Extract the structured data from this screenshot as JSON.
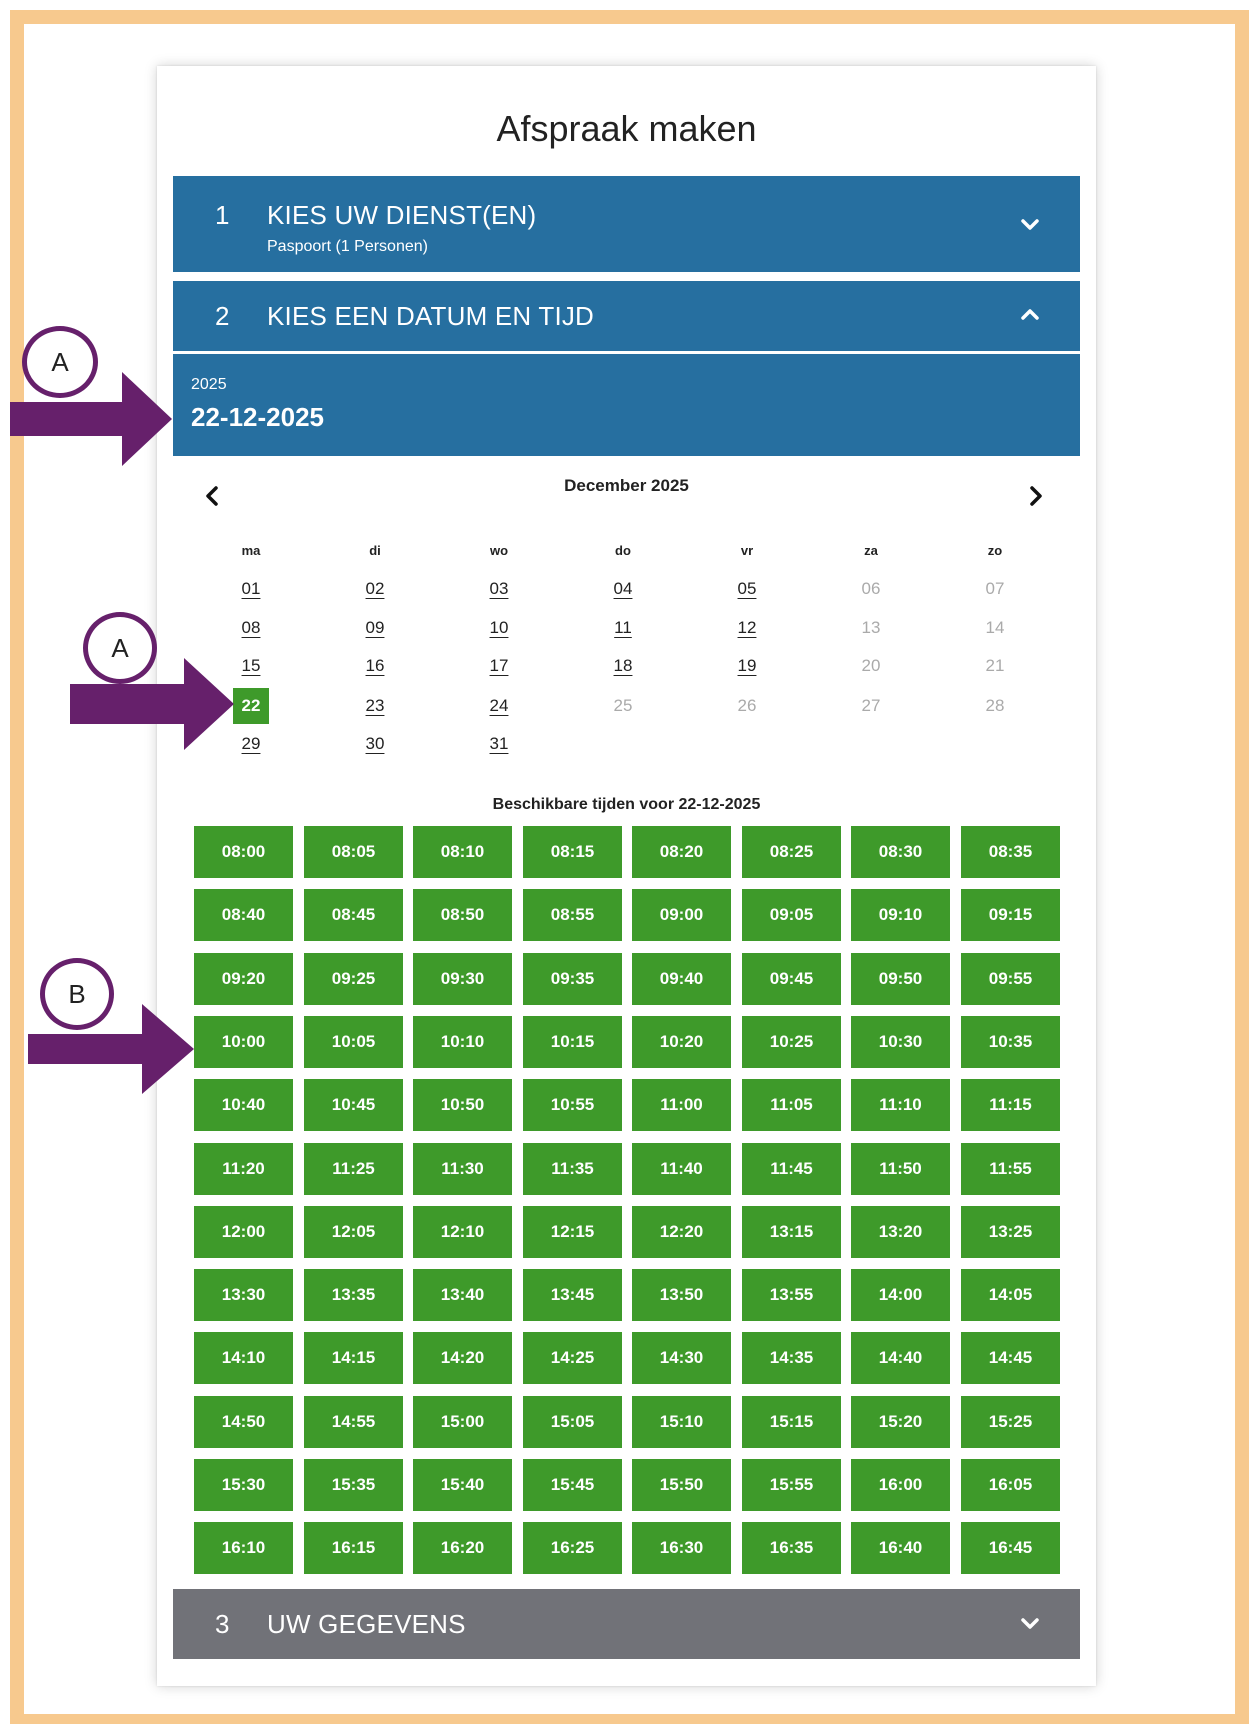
{
  "page_title": "Afspraak maken",
  "steps": [
    {
      "number": "1",
      "title": "KIES UW DIENST(EN)",
      "subtitle": "Paspoort (1 Personen)",
      "chevron": "chevron-down-icon"
    },
    {
      "number": "2",
      "title": "KIES EEN DATUM EN TIJD",
      "chevron": "chevron-up-icon"
    },
    {
      "number": "3",
      "title": "UW GEGEVENS",
      "chevron": "chevron-down-icon"
    }
  ],
  "selected_date": {
    "year": "2025",
    "full": "22-12-2025"
  },
  "calendar": {
    "month_label": "December 2025",
    "weekdays": [
      "ma",
      "di",
      "wo",
      "do",
      "vr",
      "za",
      "zo"
    ],
    "weeks": [
      [
        {
          "d": "01",
          "s": "on"
        },
        {
          "d": "02",
          "s": "on"
        },
        {
          "d": "03",
          "s": "on"
        },
        {
          "d": "04",
          "s": "on"
        },
        {
          "d": "05",
          "s": "on"
        },
        {
          "d": "06",
          "s": "off"
        },
        {
          "d": "07",
          "s": "off"
        }
      ],
      [
        {
          "d": "08",
          "s": "on"
        },
        {
          "d": "09",
          "s": "on"
        },
        {
          "d": "10",
          "s": "on"
        },
        {
          "d": "11",
          "s": "on"
        },
        {
          "d": "12",
          "s": "on"
        },
        {
          "d": "13",
          "s": "off"
        },
        {
          "d": "14",
          "s": "off"
        }
      ],
      [
        {
          "d": "15",
          "s": "on"
        },
        {
          "d": "16",
          "s": "on"
        },
        {
          "d": "17",
          "s": "on"
        },
        {
          "d": "18",
          "s": "on"
        },
        {
          "d": "19",
          "s": "on"
        },
        {
          "d": "20",
          "s": "off"
        },
        {
          "d": "21",
          "s": "off"
        }
      ],
      [
        {
          "d": "22",
          "s": "sel"
        },
        {
          "d": "23",
          "s": "on"
        },
        {
          "d": "24",
          "s": "on"
        },
        {
          "d": "25",
          "s": "off"
        },
        {
          "d": "26",
          "s": "off"
        },
        {
          "d": "27",
          "s": "off"
        },
        {
          "d": "28",
          "s": "off"
        }
      ],
      [
        {
          "d": "29",
          "s": "on"
        },
        {
          "d": "30",
          "s": "on"
        },
        {
          "d": "31",
          "s": "on"
        }
      ]
    ]
  },
  "times_heading": "Beschikbare tijden voor 22-12-2025",
  "time_slots": [
    "08:00",
    "08:05",
    "08:10",
    "08:15",
    "08:20",
    "08:25",
    "08:30",
    "08:35",
    "08:40",
    "08:45",
    "08:50",
    "08:55",
    "09:00",
    "09:05",
    "09:10",
    "09:15",
    "09:20",
    "09:25",
    "09:30",
    "09:35",
    "09:40",
    "09:45",
    "09:50",
    "09:55",
    "10:00",
    "10:05",
    "10:10",
    "10:15",
    "10:20",
    "10:25",
    "10:30",
    "10:35",
    "10:40",
    "10:45",
    "10:50",
    "10:55",
    "11:00",
    "11:05",
    "11:10",
    "11:15",
    "11:20",
    "11:25",
    "11:30",
    "11:35",
    "11:40",
    "11:45",
    "11:50",
    "11:55",
    "12:00",
    "12:05",
    "12:10",
    "12:15",
    "12:20",
    "13:15",
    "13:20",
    "13:25",
    "13:30",
    "13:35",
    "13:40",
    "13:45",
    "13:50",
    "13:55",
    "14:00",
    "14:05",
    "14:10",
    "14:15",
    "14:20",
    "14:25",
    "14:30",
    "14:35",
    "14:40",
    "14:45",
    "14:50",
    "14:55",
    "15:00",
    "15:05",
    "15:10",
    "15:15",
    "15:20",
    "15:25",
    "15:30",
    "15:35",
    "15:40",
    "15:45",
    "15:50",
    "15:55",
    "16:00",
    "16:05",
    "16:10",
    "16:15",
    "16:20",
    "16:25",
    "16:30",
    "16:35",
    "16:40",
    "16:45"
  ],
  "annotations": [
    {
      "label": "A"
    },
    {
      "label": "A"
    },
    {
      "label": "B"
    }
  ],
  "colors": {
    "step_blue": "#266fa0",
    "step_grey": "#717278",
    "slot_green": "#3e9a2a",
    "frame": "#f7c98e",
    "annotation_purple": "#66206b"
  }
}
